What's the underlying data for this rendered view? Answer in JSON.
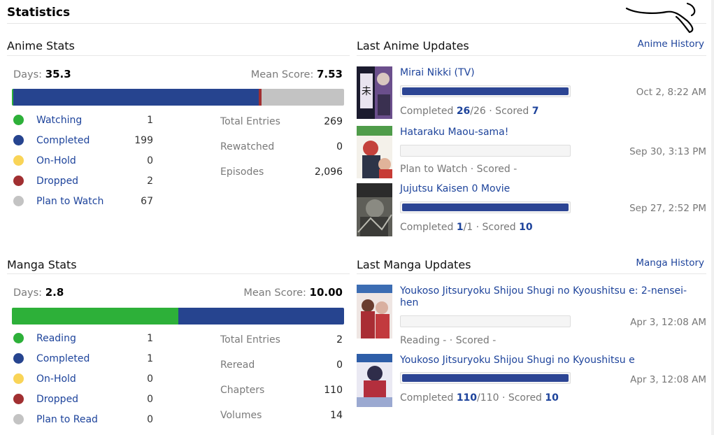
{
  "page": {
    "title": "Statistics"
  },
  "colors": {
    "watching": "#2db039",
    "completed": "#26448f",
    "on_hold": "#f9d457",
    "dropped": "#a12f31",
    "plan": "#c3c3c3",
    "link": "#1d439b"
  },
  "anime_stats": {
    "title": "Anime Stats",
    "days_label": "Days:",
    "days_value": "35.3",
    "mean_label": "Mean Score:",
    "mean_value": "7.53",
    "bar": {
      "watching": 1,
      "completed": 199,
      "on_hold": 0,
      "dropped": 2,
      "plan": 67
    },
    "legend": [
      {
        "label": "Watching",
        "count": "1"
      },
      {
        "label": "Completed",
        "count": "199"
      },
      {
        "label": "On-Hold",
        "count": "0"
      },
      {
        "label": "Dropped",
        "count": "2"
      },
      {
        "label": "Plan to Watch",
        "count": "67"
      }
    ],
    "totals": [
      {
        "label": "Total Entries",
        "value": "269"
      },
      {
        "label": "Rewatched",
        "value": "0"
      },
      {
        "label": "Episodes",
        "value": "2,096"
      }
    ]
  },
  "manga_stats": {
    "title": "Manga Stats",
    "days_label": "Days:",
    "days_value": "2.8",
    "mean_label": "Mean Score:",
    "mean_value": "10.00",
    "bar": {
      "reading": 1,
      "completed": 1,
      "on_hold": 0,
      "dropped": 0,
      "plan": 0
    },
    "legend": [
      {
        "label": "Reading",
        "count": "1"
      },
      {
        "label": "Completed",
        "count": "1"
      },
      {
        "label": "On-Hold",
        "count": "0"
      },
      {
        "label": "Dropped",
        "count": "0"
      },
      {
        "label": "Plan to Read",
        "count": "0"
      }
    ],
    "totals": [
      {
        "label": "Total Entries",
        "value": "2"
      },
      {
        "label": "Reread",
        "value": "0"
      },
      {
        "label": "Chapters",
        "value": "110"
      },
      {
        "label": "Volumes",
        "value": "14"
      }
    ]
  },
  "anime_updates": {
    "title": "Last Anime Updates",
    "history_link": "Anime History",
    "items": [
      {
        "title": "Mirai Nikki (TV)",
        "progress": 1.0,
        "date": "Oct 2, 8:22 AM",
        "status": "Completed",
        "sep1": " ",
        "current": "26",
        "total": "/26",
        "sep2": " · Scored ",
        "score": "7"
      },
      {
        "title": "Hataraku Maou-sama!",
        "progress": 0.0,
        "date": "Sep 30, 3:13 PM",
        "status": "Plan to Watch",
        "sep1": "",
        "current": "",
        "total": "",
        "sep2": " · Scored -",
        "score": ""
      },
      {
        "title": "Jujutsu Kaisen 0 Movie",
        "progress": 1.0,
        "date": "Sep 27, 2:52 PM",
        "status": "Completed",
        "sep1": " ",
        "current": "1",
        "total": "/1",
        "sep2": " · Scored ",
        "score": "10"
      }
    ]
  },
  "manga_updates": {
    "title": "Last Manga Updates",
    "history_link": "Manga History",
    "items": [
      {
        "title": "Youkoso Jitsuryoku Shijou Shugi no Kyoushitsu e: 2-nensei-hen",
        "progress": 0.0,
        "date": "Apr 3, 12:08 AM",
        "status": "Reading",
        "sep1": " -",
        "current": "",
        "total": "",
        "sep2": " · Scored -",
        "score": ""
      },
      {
        "title": "Youkoso Jitsuryoku Shijou Shugi no Kyoushitsu e",
        "progress": 1.0,
        "date": "Apr 3, 12:08 AM",
        "status": "Completed",
        "sep1": " ",
        "current": "110",
        "total": "/110",
        "sep2": " · Scored ",
        "score": "10"
      }
    ]
  }
}
